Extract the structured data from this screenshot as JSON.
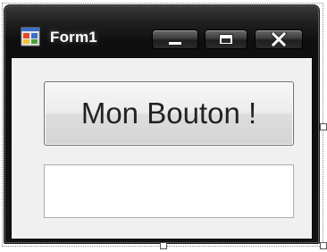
{
  "window": {
    "title": "Form1",
    "icon": "form-app-icon",
    "caption_buttons": {
      "minimize": "minimize-icon",
      "maximize": "maximize-icon",
      "close": "close-icon"
    }
  },
  "form": {
    "button_label": "Mon Bouton !",
    "textbox_value": ""
  },
  "colors": {
    "title_text": "#ffffff",
    "frame": "#121212",
    "client_background": "#f0f0f0",
    "button_text": "#222222"
  }
}
